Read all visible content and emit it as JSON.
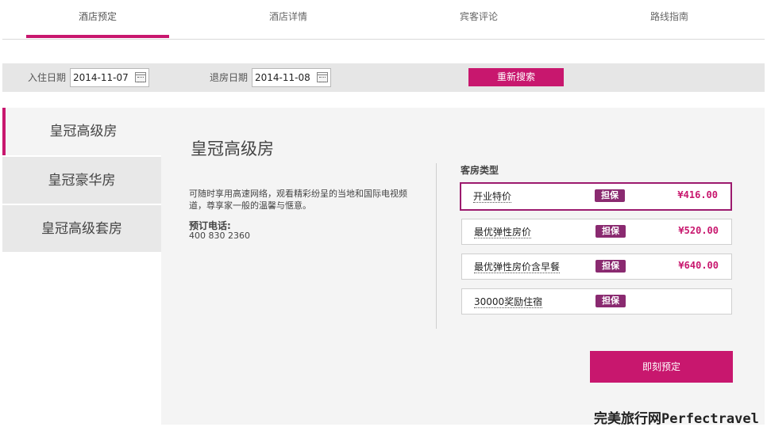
{
  "tabs": [
    {
      "label": "酒店预定",
      "active": true
    },
    {
      "label": "酒店详情",
      "active": false
    },
    {
      "label": "宾客评论",
      "active": false
    },
    {
      "label": "路线指南",
      "active": false
    }
  ],
  "search": {
    "checkin_label": "入住日期",
    "checkin_value": "2014-11-07",
    "checkout_label": "退房日期",
    "checkout_value": "2014-11-08",
    "research_label": "重新搜索",
    "calendar_icon": "calendar-icon"
  },
  "rooms": [
    {
      "name": "皇冠高级房",
      "active": true
    },
    {
      "name": "皇冠豪华房",
      "active": false
    },
    {
      "name": "皇冠高级套房",
      "active": false
    }
  ],
  "detail": {
    "title": "皇冠高级房",
    "description": "可随时享用高速网络，观看精彩纷呈的当地和国际电视频道，尊享家一般的温馨与惬意。",
    "phone_label": "预订电话:",
    "phone_number": "400 830 2360"
  },
  "rate_types": {
    "label": "客房类型",
    "items": [
      {
        "name": "开业特价",
        "badge": "担保",
        "price": "¥416.00",
        "selected": true
      },
      {
        "name": "最优弹性房价",
        "badge": "担保",
        "price": "¥520.00",
        "selected": false
      },
      {
        "name": "最优弹性房价含早餐",
        "badge": "担保",
        "price": "¥640.00",
        "selected": false
      },
      {
        "name": "30000奖励住宿",
        "badge": "担保",
        "price": "",
        "selected": false
      }
    ]
  },
  "book_label": "即刻预定",
  "watermark": "完美旅行网Perfectravel",
  "colors": {
    "accent": "#c8176e",
    "badge": "#8a2a70"
  }
}
